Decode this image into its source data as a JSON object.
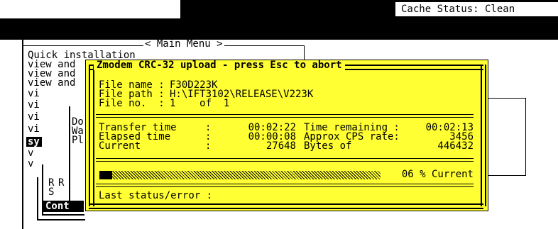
{
  "header": {
    "cache_status": "Cache Status: Clean"
  },
  "main_menu": {
    "title": "< Main Menu >",
    "items": [
      "Quick installation",
      "view and",
      "view and",
      "view and",
      "vi",
      "vi",
      "vi",
      "vi"
    ],
    "selected_item": "sy",
    "lower_item_1": "v",
    "lower_item_2": "v"
  },
  "submenu": {
    "items": [
      "Do",
      "Wa",
      "Pl"
    ],
    "row_r1": "R",
    "row_r2": "R",
    "row_s": "S",
    "selected": "Cont"
  },
  "popup": {
    "title": "Zmodem CRC-32 upload - press Esc to abort",
    "file_name_label": "File name :",
    "file_name_value": "F30D223K",
    "file_path_label": "File path :",
    "file_path_value": "H:\\IFT3102\\RELEASE\\V223K",
    "file_no_label": "File no.  :",
    "file_no_value": "1    of  1",
    "transfer_time_label": "Transfer time",
    "transfer_time_value": "00:02:22",
    "elapsed_time_label": "Elapsed time",
    "elapsed_time_value": "00:00:08",
    "current_label": "Current",
    "current_value": "27648",
    "colon": ":",
    "time_remaining_label": "Time remaining :",
    "time_remaining_value": "00:02:13",
    "cps_label": "Approx CPS rate:",
    "cps_value": "3456",
    "bytes_of_label": "Bytes of",
    "bytes_of_value": "446432",
    "progress_percent": 6,
    "progress_text": "06 % Current",
    "last_status_label": "Last status/error :"
  },
  "colors": {
    "popup_bg": "#ffff33",
    "terminal_bg": "#ffffff",
    "header_bg": "#000000"
  }
}
